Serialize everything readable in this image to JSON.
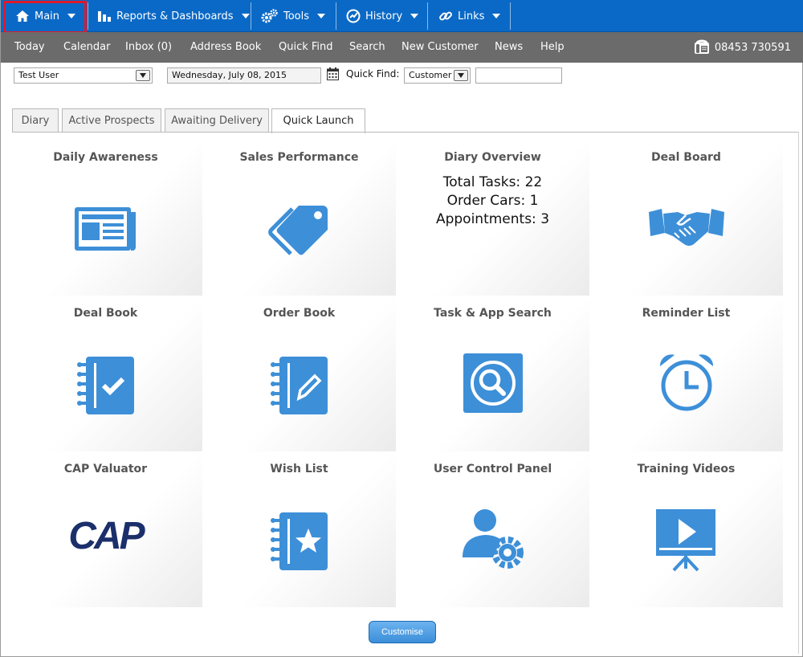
{
  "top_menu": {
    "items": [
      {
        "label": "Main",
        "icon": "home-icon"
      },
      {
        "label": "Reports & Dashboards",
        "icon": "bar-chart-icon"
      },
      {
        "label": "Tools",
        "icon": "gears-icon"
      },
      {
        "label": "History",
        "icon": "gauge-icon"
      },
      {
        "label": "Links",
        "icon": "link-icon"
      }
    ]
  },
  "nav": {
    "items": [
      "Today",
      "Calendar",
      "Inbox (0)",
      "Address Book",
      "Quick Find",
      "Search",
      "New Customer",
      "News",
      "Help"
    ],
    "phone": "08453 730591"
  },
  "controls": {
    "user_select": "Test User",
    "date": "Wednesday, July 08, 2015",
    "quick_find_label": "Quick Find:",
    "quick_find_type": "Customer",
    "quick_find_value": ""
  },
  "tabs": [
    "Diary",
    "Active Prospects",
    "Awaiting Delivery",
    "Quick Launch"
  ],
  "tiles": [
    {
      "title": "Daily Awareness",
      "icon": "newspaper-icon"
    },
    {
      "title": "Sales Performance",
      "icon": "tag-icon"
    },
    {
      "title": "Diary Overview",
      "stats": [
        "Total Tasks: 22",
        "Order Cars: 1",
        "Appointments: 3"
      ]
    },
    {
      "title": "Deal Board",
      "icon": "handshake-icon"
    },
    {
      "title": "Deal Book",
      "icon": "notebook-check-icon"
    },
    {
      "title": "Order Book",
      "icon": "notebook-pen-icon"
    },
    {
      "title": "Task & App Search",
      "icon": "search-icon"
    },
    {
      "title": "Reminder List",
      "icon": "alarm-clock-icon"
    },
    {
      "title": "CAP Valuator",
      "logo_text": "CAP"
    },
    {
      "title": "Wish List",
      "icon": "notebook-star-icon"
    },
    {
      "title": "User Control Panel",
      "icon": "user-gear-icon"
    },
    {
      "title": "Training Videos",
      "icon": "video-board-icon"
    }
  ],
  "customise_label": "Customise",
  "colors": {
    "brand_blue": "#0a69c6",
    "icon_blue": "#3d8fd8",
    "nav_grey": "#6b6b6b",
    "active_outline": "#e0192b",
    "cap_navy": "#1b2f6b"
  }
}
